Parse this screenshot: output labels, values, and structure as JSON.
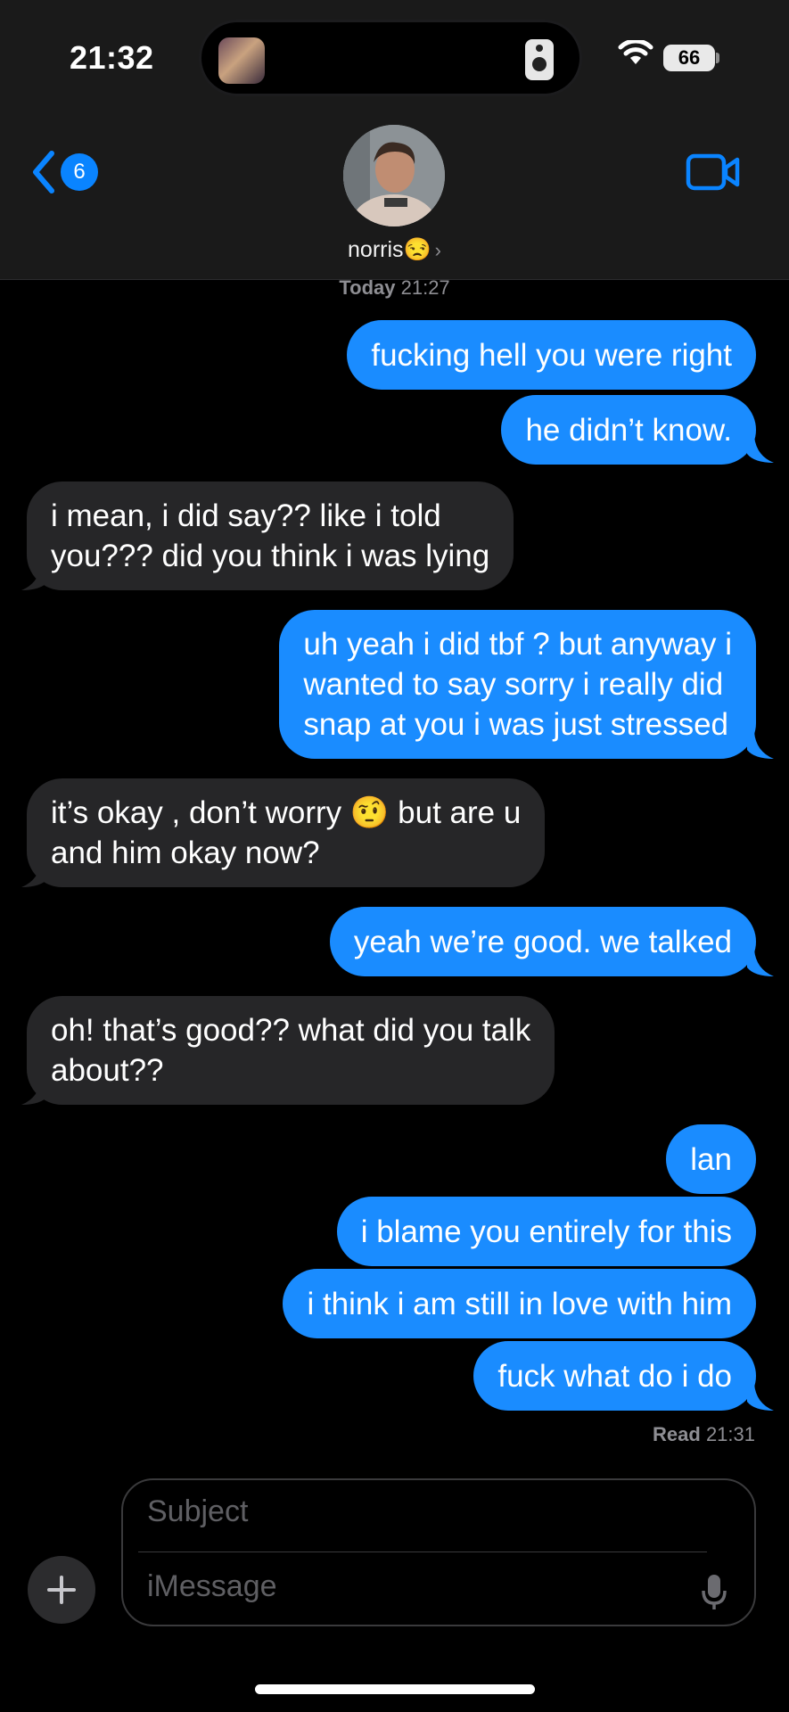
{
  "status_bar": {
    "time": "21:32",
    "battery": "66"
  },
  "header": {
    "back_count": "6",
    "contact_name": "norris😒",
    "contact_chevron": "›"
  },
  "timestamp": {
    "day": "Today",
    "time": "21:27"
  },
  "messages": [
    {
      "from": "me",
      "lines": [
        "fucking hell you were right"
      ]
    },
    {
      "from": "me",
      "lines": [
        "he didn’t know."
      ]
    },
    {
      "from": "them",
      "lines": [
        "i mean, i did say?? like i told",
        "you??? did you think i was lying"
      ]
    },
    {
      "from": "me",
      "lines": [
        "uh yeah i did tbf ? but anyway i",
        "wanted to say sorry i really did",
        "snap at you i was just stressed"
      ]
    },
    {
      "from": "them",
      "lines": [
        "it’s okay , don’t worry 🤨 but are u",
        "and him okay now?"
      ]
    },
    {
      "from": "me",
      "lines": [
        "yeah we’re good. we talked"
      ]
    },
    {
      "from": "them",
      "lines": [
        "oh! that’s good?? what did you talk",
        "about??"
      ]
    },
    {
      "from": "me",
      "lines": [
        "lan"
      ]
    },
    {
      "from": "me",
      "lines": [
        "i blame you entirely for this"
      ]
    },
    {
      "from": "me",
      "lines": [
        "i think i am still in love with him"
      ]
    },
    {
      "from": "me",
      "lines": [
        "fuck what do i do"
      ]
    }
  ],
  "read_receipt": {
    "label": "Read",
    "time": "21:31"
  },
  "composer": {
    "subject_placeholder": "Subject",
    "message_placeholder": "iMessage"
  },
  "colors": {
    "sent_bubble": "#1a8cff",
    "received_bubble": "#262628",
    "accent": "#0a84ff"
  },
  "icons": [
    "back-chevron-icon",
    "video-call-icon",
    "wifi-icon",
    "plus-icon",
    "microphone-icon"
  ]
}
